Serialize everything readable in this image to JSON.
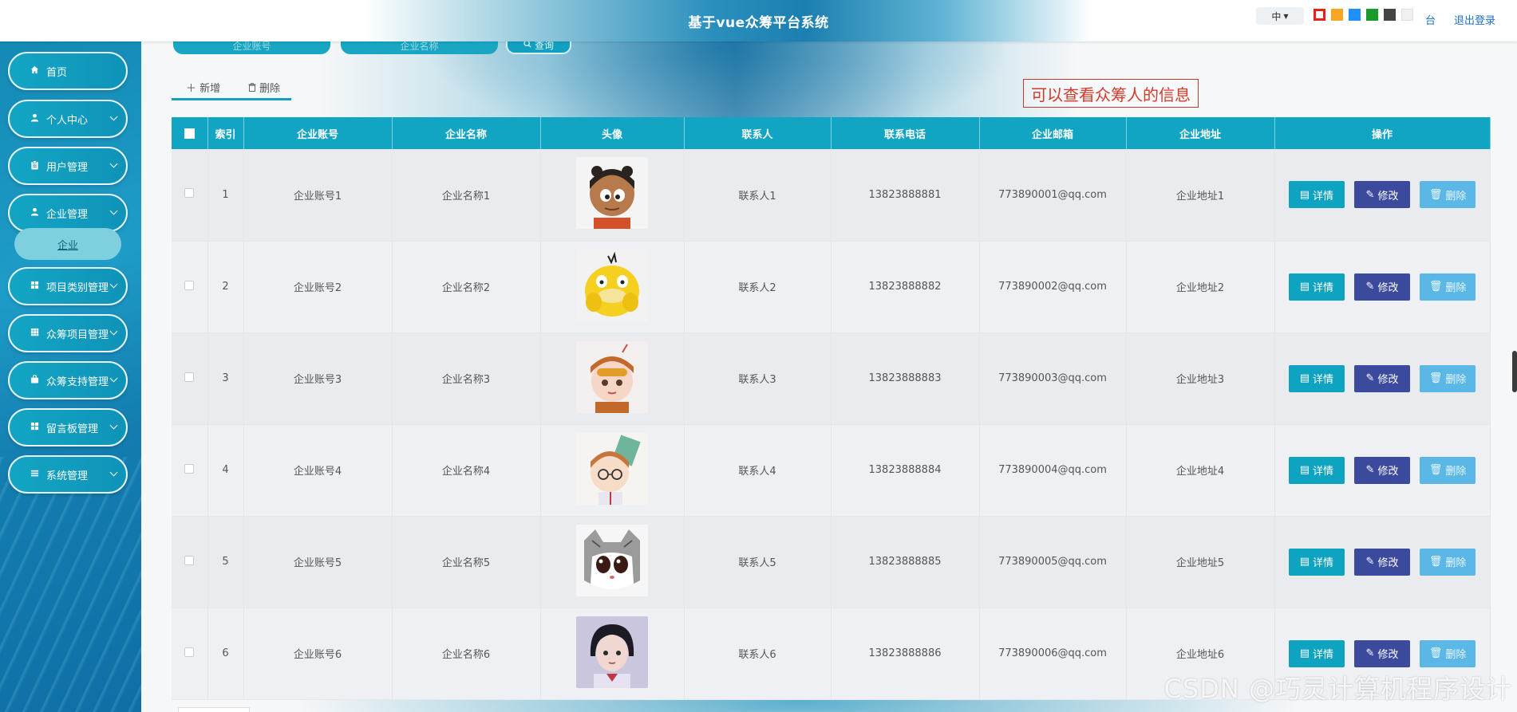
{
  "header": {
    "title": "基于vue众筹平台系统",
    "lang": "中",
    "theme_colors": [
      "#e2231a",
      "#f5a623",
      "#1e90ff",
      "#1a9a2a",
      "#444444",
      "#f0f0f0"
    ],
    "home_link": "台",
    "logout": "退出登录"
  },
  "sidebar": {
    "items": [
      {
        "label": "首页",
        "icon": "home-icon"
      },
      {
        "label": "个人中心",
        "icon": "user-icon"
      },
      {
        "label": "用户管理",
        "icon": "clipboard-icon"
      },
      {
        "label": "企业管理",
        "icon": "user-icon"
      },
      {
        "label": "项目类别管理",
        "icon": "grid-icon"
      },
      {
        "label": "众筹项目管理",
        "icon": "table-icon"
      },
      {
        "label": "众筹支持管理",
        "icon": "bag-icon"
      },
      {
        "label": "留言板管理",
        "icon": "grid-icon"
      },
      {
        "label": "系统管理",
        "icon": "list-icon"
      }
    ],
    "active_sub": "企业"
  },
  "search": {
    "account_placeholder": "企业账号",
    "name_placeholder": "企业名称",
    "query_label": "查询"
  },
  "toolbar": {
    "add_label": "新增",
    "delete_label": "删除"
  },
  "note": "可以查看众筹人的信息",
  "table": {
    "columns": [
      "索引",
      "企业账号",
      "企业名称",
      "头像",
      "联系人",
      "联系电话",
      "企业邮箱",
      "企业地址",
      "操作"
    ],
    "rows": [
      {
        "index": "1",
        "account": "企业账号1",
        "name": "企业名称1",
        "contact": "联系人1",
        "phone": "13823888881",
        "email": "773890001@qq.com",
        "address": "企业地址1"
      },
      {
        "index": "2",
        "account": "企业账号2",
        "name": "企业名称2",
        "contact": "联系人2",
        "phone": "13823888882",
        "email": "773890002@qq.com",
        "address": "企业地址2"
      },
      {
        "index": "3",
        "account": "企业账号3",
        "name": "企业名称3",
        "contact": "联系人3",
        "phone": "13823888883",
        "email": "773890003@qq.com",
        "address": "企业地址3"
      },
      {
        "index": "4",
        "account": "企业账号4",
        "name": "企业名称4",
        "contact": "联系人4",
        "phone": "13823888884",
        "email": "773890004@qq.com",
        "address": "企业地址4"
      },
      {
        "index": "5",
        "account": "企业账号5",
        "name": "企业名称5",
        "contact": "联系人5",
        "phone": "13823888885",
        "email": "773890005@qq.com",
        "address": "企业地址5"
      },
      {
        "index": "6",
        "account": "企业账号6",
        "name": "企业名称6",
        "contact": "联系人6",
        "phone": "13823888886",
        "email": "773890006@qq.com",
        "address": "企业地址6"
      }
    ],
    "actions": {
      "detail": "详情",
      "edit": "修改",
      "delete": "删除"
    }
  },
  "watermark": "CSDN @巧灵计算机程序设计"
}
